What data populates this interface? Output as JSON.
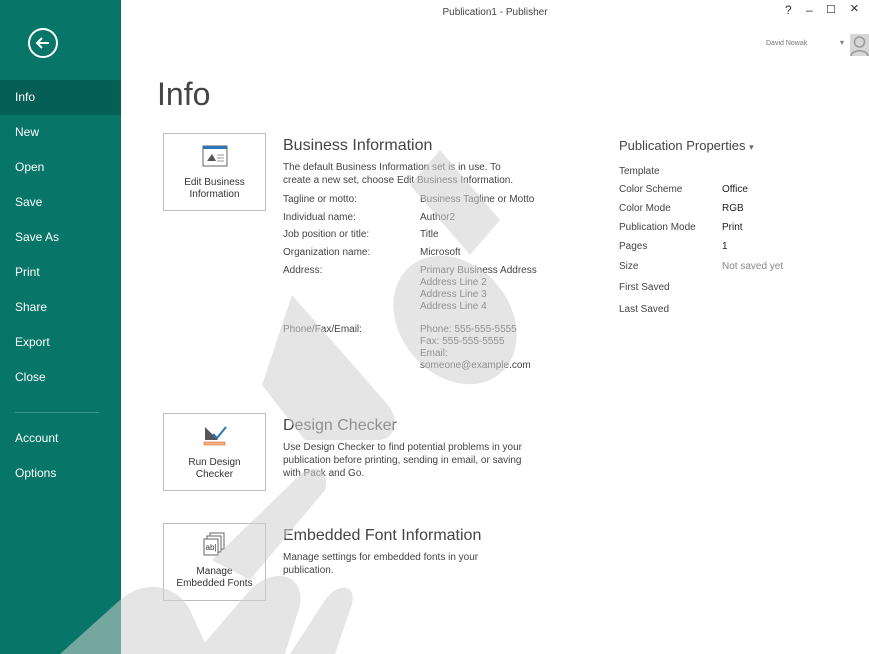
{
  "app": {
    "title": "Publication1 - Publisher",
    "help": "?",
    "minimize": "–",
    "maximize": "☐",
    "close": "×",
    "user_name": "David Nowak",
    "user_caret": "▾"
  },
  "sidebar": {
    "items": [
      {
        "label": "Info"
      },
      {
        "label": "New"
      },
      {
        "label": "Open"
      },
      {
        "label": "Save"
      },
      {
        "label": "Save As"
      },
      {
        "label": "Print"
      },
      {
        "label": "Share"
      },
      {
        "label": "Export"
      },
      {
        "label": "Close"
      },
      {
        "label": "Account"
      },
      {
        "label": "Options"
      }
    ]
  },
  "page": {
    "title": "Info"
  },
  "business": {
    "button_line1": "Edit Business",
    "button_line2": "Information",
    "title": "Business Information",
    "desc_line1": "The default Business Information set is in use. To",
    "desc_line2": "create a new set, choose Edit Business Information.",
    "fields": [
      {
        "label": "Tagline or motto:",
        "value": "Business Tagline or Motto"
      },
      {
        "label": "Individual name:",
        "value": "Author2"
      },
      {
        "label": "Job position or title:",
        "value": "Title"
      },
      {
        "label": "Organization name:",
        "value": "Microsoft"
      },
      {
        "label": "Address:",
        "lines": [
          "Primary Business Address",
          "Address Line 2",
          "Address Line 3",
          "Address Line 4"
        ]
      },
      {
        "label": "Phone/Fax/Email:",
        "lines": [
          "Phone: 555-555-5555",
          "Fax: 555-555-5555",
          "Email:",
          "someone@example.com"
        ]
      }
    ]
  },
  "design": {
    "button_line1": "Run Design",
    "button_line2": "Checker",
    "title": "Design Checker",
    "desc_line1": "Use Design Checker to find potential problems in your",
    "desc_line2": "publication before printing, sending in email, or saving",
    "desc_line3": "with Pack and Go."
  },
  "fonts": {
    "button_line1": "Manage",
    "button_line2": "Embedded Fonts",
    "title": "Embedded Font Information",
    "desc_line1": "Manage settings for embedded fonts in your",
    "desc_line2": "publication."
  },
  "properties": {
    "title": "Publication Properties",
    "caret": "▾",
    "rows": [
      {
        "label": "Template",
        "value": ""
      },
      {
        "label": "Color Scheme",
        "value": "Office"
      },
      {
        "label": "Color Mode",
        "value": "RGB"
      },
      {
        "label": "Publication Mode",
        "value": "Print"
      },
      {
        "label": "Pages",
        "value": "1"
      },
      {
        "label": "Size",
        "value": "Not saved yet"
      },
      {
        "label": "First Saved",
        "value": ""
      },
      {
        "label": "Last Saved",
        "value": ""
      }
    ]
  },
  "colors": {
    "sidebar": "#077568",
    "sidebar_active": "#055f54",
    "watermark": "#dcdcdc"
  }
}
